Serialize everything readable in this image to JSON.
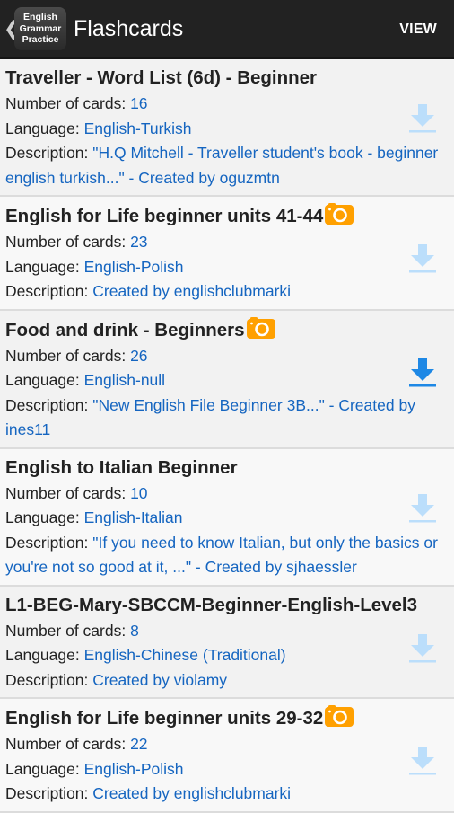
{
  "appbar": {
    "back_glyph": "❮",
    "logo_lines": [
      "English",
      "Grammar",
      "Practice"
    ],
    "title": "Flashcards",
    "action": "VIEW"
  },
  "labels": {
    "cards": "Number of cards: ",
    "language": "Language: ",
    "description": "Description: "
  },
  "colors": {
    "link": "#1565c0",
    "download_active": "#1e88e5",
    "download_faded": "#bbdefb",
    "camera": "#ffa000"
  },
  "items": [
    {
      "title": "Traveller - Word List (6d) - Beginner",
      "has_photo": false,
      "cards": "16",
      "language": "English-Turkish",
      "description": "\"H.Q Mitchell - Traveller student's book - beginner english turkish...\" - Created by oguzmtn",
      "download_state": "faded"
    },
    {
      "title": "English for Life beginner units 41-44",
      "has_photo": true,
      "cards": "23",
      "language": "English-Polish",
      "description": "Created by englishclubmarki",
      "download_state": "faded"
    },
    {
      "title": "Food and drink - Beginners",
      "has_photo": true,
      "cards": "26",
      "language": "English-null",
      "description": "\"New English File Beginner 3B...\" - Created by ines11",
      "download_state": "active"
    },
    {
      "title": "English to Italian Beginner",
      "has_photo": false,
      "cards": "10",
      "language": "English-Italian",
      "description": "\"If you need to know Italian, but only the basics or you're not so good at it, ...\" - Created by sjhaessler",
      "download_state": "faded"
    },
    {
      "title": "L1-BEG-Mary-SBCCM-Beginner-English-Level3",
      "has_photo": false,
      "cards": "8",
      "language": "English-Chinese (Traditional)",
      "description": "Created by violamy",
      "download_state": "faded"
    },
    {
      "title": "English for Life beginner units 29-32",
      "has_photo": true,
      "cards": "22",
      "language": "English-Polish",
      "description": "Created by englishclubmarki",
      "download_state": "faded"
    }
  ]
}
